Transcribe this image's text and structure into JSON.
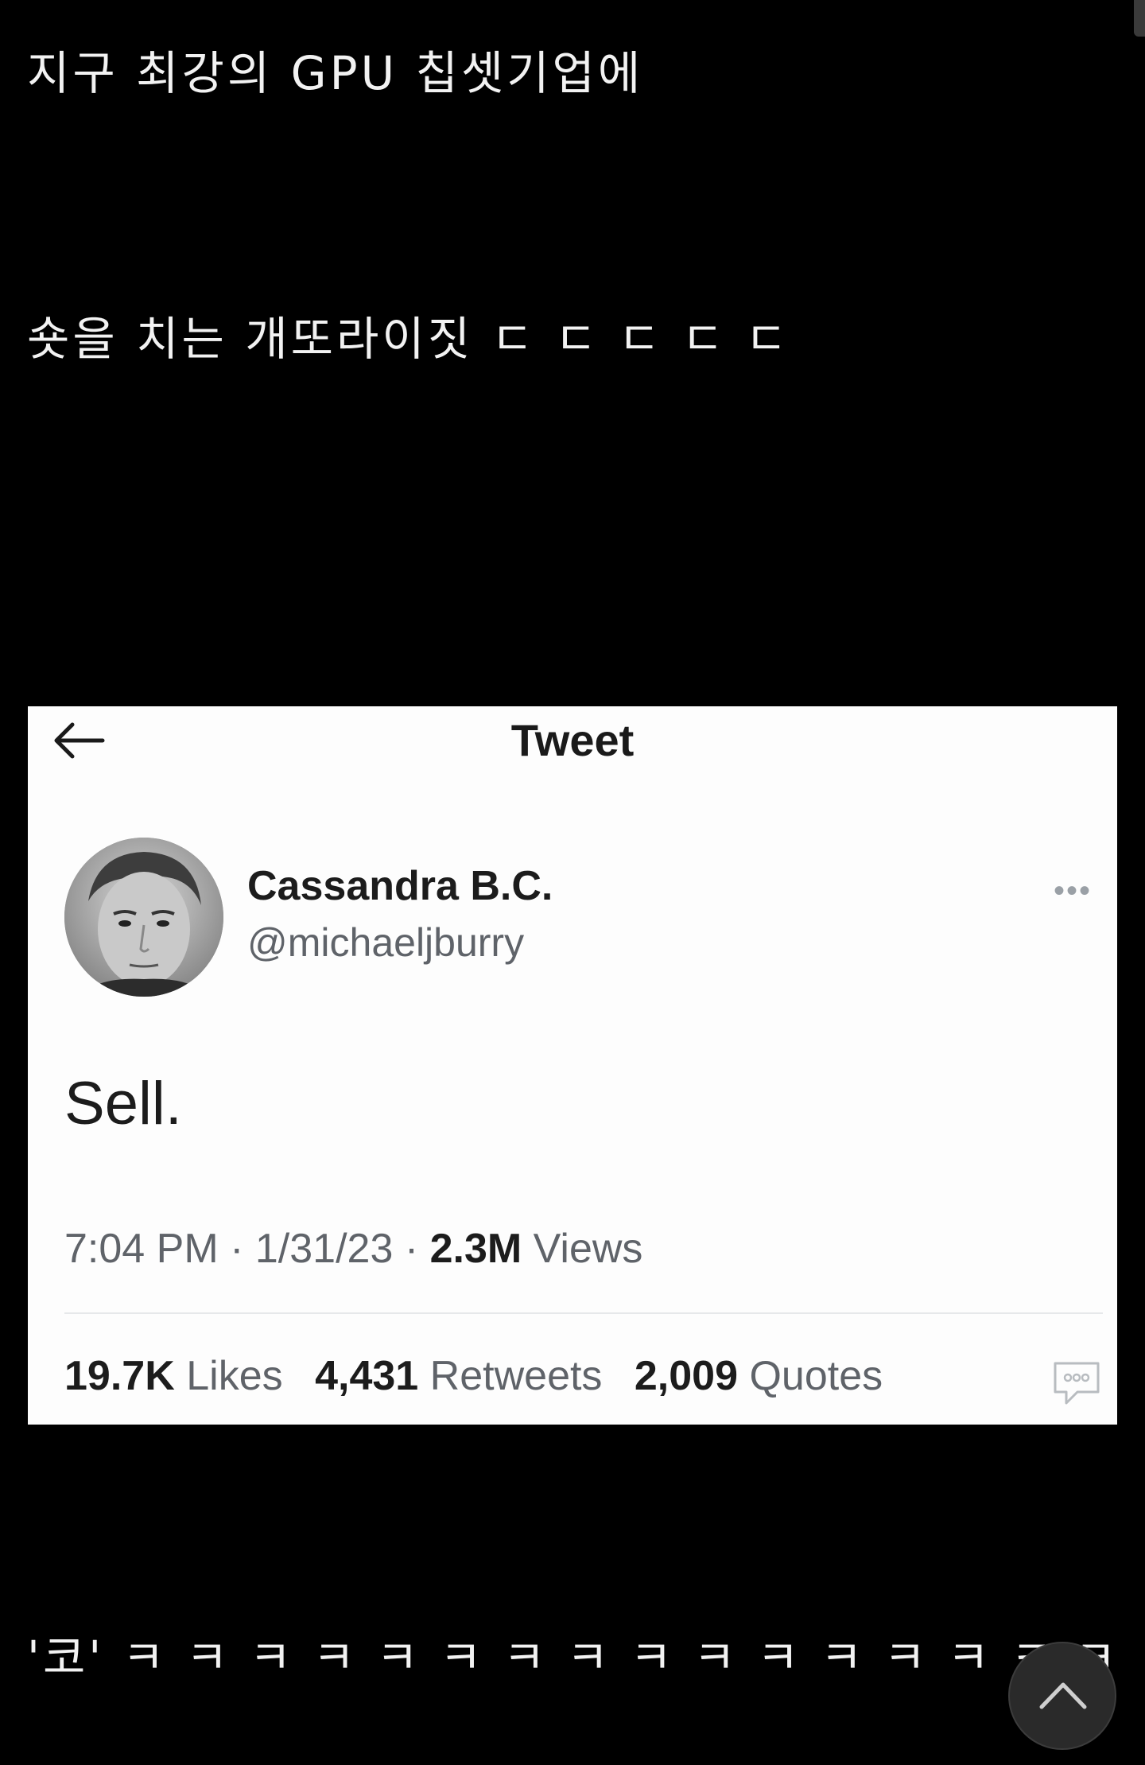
{
  "post": {
    "caption_lines": [
      "지구 최강의 GPU 칩셋기업에",
      "숏을 치는 개또라이짓 ㄷ ㄷ ㄷ ㄷ ㄷ",
      "'코' ㅋ ㅋ ㅋ ㅋ ㅋ ㅋ ㅋ ㅋ ㅋ ㅋ ㅋ ㅋ ㅋ ㅋ ㅋ ㅋ"
    ]
  },
  "tweet": {
    "header_title": "Tweet",
    "author_name": "Cassandra B.C.",
    "author_handle": "@michaeljburry",
    "more_glyph": "•••",
    "text": "Sell.",
    "time": "7:04 PM",
    "date": "1/31/23",
    "separator": " · ",
    "views_count": "2.3M",
    "views_label": "Views",
    "stats": [
      {
        "count": "19.7K",
        "label": "Likes"
      },
      {
        "count": "4,431",
        "label": "Retweets"
      },
      {
        "count": "2,009",
        "label": "Quotes"
      }
    ]
  },
  "icons": {
    "back": "arrow-left-icon",
    "more": "more-horizontal-icon",
    "comment": "comment-bubble-icon",
    "scroll_top": "chevron-up-icon"
  },
  "colors": {
    "background": "#000000",
    "tweet_card": "#fdfdfd",
    "text_primary": "#1c1c1c",
    "text_secondary": "#5f6369"
  }
}
